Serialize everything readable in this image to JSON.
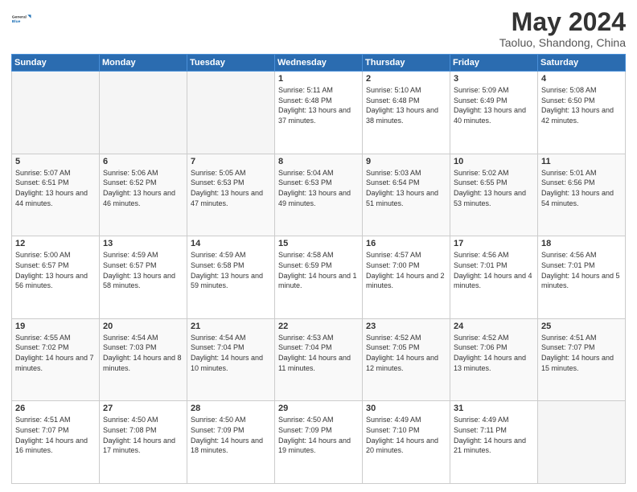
{
  "header": {
    "logo": {
      "general": "General",
      "blue": "Blue"
    },
    "title": "May 2024",
    "location": "Taoluo, Shandong, China"
  },
  "weekdays": [
    "Sunday",
    "Monday",
    "Tuesday",
    "Wednesday",
    "Thursday",
    "Friday",
    "Saturday"
  ],
  "weeks": [
    [
      {
        "day": "",
        "info": ""
      },
      {
        "day": "",
        "info": ""
      },
      {
        "day": "",
        "info": ""
      },
      {
        "day": "1",
        "info": "Sunrise: 5:11 AM\nSunset: 6:48 PM\nDaylight: 13 hours and 37 minutes."
      },
      {
        "day": "2",
        "info": "Sunrise: 5:10 AM\nSunset: 6:48 PM\nDaylight: 13 hours and 38 minutes."
      },
      {
        "day": "3",
        "info": "Sunrise: 5:09 AM\nSunset: 6:49 PM\nDaylight: 13 hours and 40 minutes."
      },
      {
        "day": "4",
        "info": "Sunrise: 5:08 AM\nSunset: 6:50 PM\nDaylight: 13 hours and 42 minutes."
      }
    ],
    [
      {
        "day": "5",
        "info": "Sunrise: 5:07 AM\nSunset: 6:51 PM\nDaylight: 13 hours and 44 minutes."
      },
      {
        "day": "6",
        "info": "Sunrise: 5:06 AM\nSunset: 6:52 PM\nDaylight: 13 hours and 46 minutes."
      },
      {
        "day": "7",
        "info": "Sunrise: 5:05 AM\nSunset: 6:53 PM\nDaylight: 13 hours and 47 minutes."
      },
      {
        "day": "8",
        "info": "Sunrise: 5:04 AM\nSunset: 6:53 PM\nDaylight: 13 hours and 49 minutes."
      },
      {
        "day": "9",
        "info": "Sunrise: 5:03 AM\nSunset: 6:54 PM\nDaylight: 13 hours and 51 minutes."
      },
      {
        "day": "10",
        "info": "Sunrise: 5:02 AM\nSunset: 6:55 PM\nDaylight: 13 hours and 53 minutes."
      },
      {
        "day": "11",
        "info": "Sunrise: 5:01 AM\nSunset: 6:56 PM\nDaylight: 13 hours and 54 minutes."
      }
    ],
    [
      {
        "day": "12",
        "info": "Sunrise: 5:00 AM\nSunset: 6:57 PM\nDaylight: 13 hours and 56 minutes."
      },
      {
        "day": "13",
        "info": "Sunrise: 4:59 AM\nSunset: 6:57 PM\nDaylight: 13 hours and 58 minutes."
      },
      {
        "day": "14",
        "info": "Sunrise: 4:59 AM\nSunset: 6:58 PM\nDaylight: 13 hours and 59 minutes."
      },
      {
        "day": "15",
        "info": "Sunrise: 4:58 AM\nSunset: 6:59 PM\nDaylight: 14 hours and 1 minute."
      },
      {
        "day": "16",
        "info": "Sunrise: 4:57 AM\nSunset: 7:00 PM\nDaylight: 14 hours and 2 minutes."
      },
      {
        "day": "17",
        "info": "Sunrise: 4:56 AM\nSunset: 7:01 PM\nDaylight: 14 hours and 4 minutes."
      },
      {
        "day": "18",
        "info": "Sunrise: 4:56 AM\nSunset: 7:01 PM\nDaylight: 14 hours and 5 minutes."
      }
    ],
    [
      {
        "day": "19",
        "info": "Sunrise: 4:55 AM\nSunset: 7:02 PM\nDaylight: 14 hours and 7 minutes."
      },
      {
        "day": "20",
        "info": "Sunrise: 4:54 AM\nSunset: 7:03 PM\nDaylight: 14 hours and 8 minutes."
      },
      {
        "day": "21",
        "info": "Sunrise: 4:54 AM\nSunset: 7:04 PM\nDaylight: 14 hours and 10 minutes."
      },
      {
        "day": "22",
        "info": "Sunrise: 4:53 AM\nSunset: 7:04 PM\nDaylight: 14 hours and 11 minutes."
      },
      {
        "day": "23",
        "info": "Sunrise: 4:52 AM\nSunset: 7:05 PM\nDaylight: 14 hours and 12 minutes."
      },
      {
        "day": "24",
        "info": "Sunrise: 4:52 AM\nSunset: 7:06 PM\nDaylight: 14 hours and 13 minutes."
      },
      {
        "day": "25",
        "info": "Sunrise: 4:51 AM\nSunset: 7:07 PM\nDaylight: 14 hours and 15 minutes."
      }
    ],
    [
      {
        "day": "26",
        "info": "Sunrise: 4:51 AM\nSunset: 7:07 PM\nDaylight: 14 hours and 16 minutes."
      },
      {
        "day": "27",
        "info": "Sunrise: 4:50 AM\nSunset: 7:08 PM\nDaylight: 14 hours and 17 minutes."
      },
      {
        "day": "28",
        "info": "Sunrise: 4:50 AM\nSunset: 7:09 PM\nDaylight: 14 hours and 18 minutes."
      },
      {
        "day": "29",
        "info": "Sunrise: 4:50 AM\nSunset: 7:09 PM\nDaylight: 14 hours and 19 minutes."
      },
      {
        "day": "30",
        "info": "Sunrise: 4:49 AM\nSunset: 7:10 PM\nDaylight: 14 hours and 20 minutes."
      },
      {
        "day": "31",
        "info": "Sunrise: 4:49 AM\nSunset: 7:11 PM\nDaylight: 14 hours and 21 minutes."
      },
      {
        "day": "",
        "info": ""
      }
    ]
  ]
}
